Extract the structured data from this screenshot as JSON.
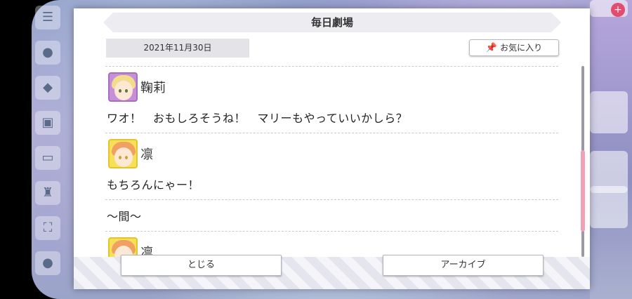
{
  "dialog": {
    "title": "毎日劇場",
    "date": "2021年11月30日",
    "favorite_label": "お気に入り"
  },
  "entries": [
    {
      "speaker": "鞠莉",
      "text": "ワオ！　おもしろそうね！　マリーもやっていいかしら？"
    },
    {
      "speaker": "凛",
      "text": "もちろんにゃー！"
    },
    {
      "narration": "～間～"
    },
    {
      "speaker": "凛"
    }
  ],
  "footer": {
    "close_label": "とじる",
    "archive_label": "アーカイブ"
  },
  "icons": {
    "favorite": "pin-icon"
  },
  "colors": {
    "scroll_thumb": "#f2a0b6",
    "title_bar": "#ededf1"
  }
}
